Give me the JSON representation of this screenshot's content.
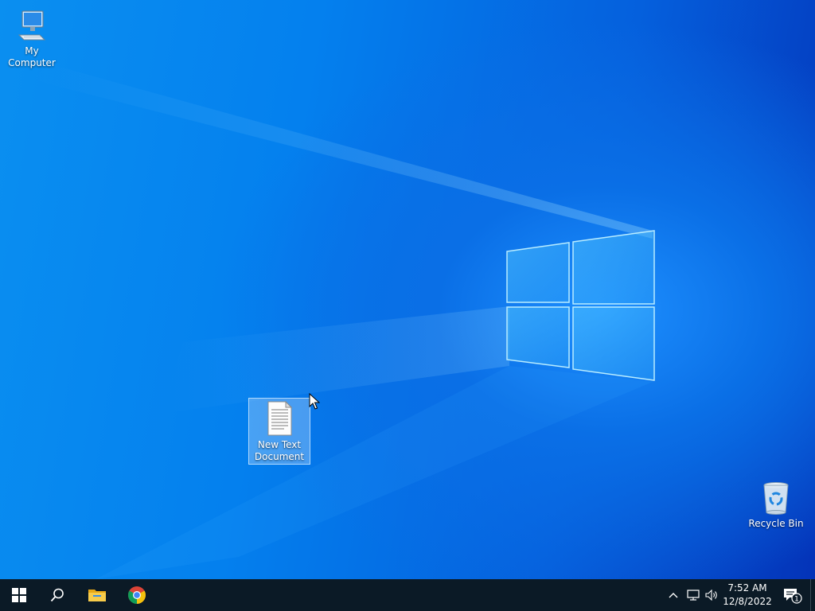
{
  "desktop": {
    "icons": [
      {
        "label": "My Computer",
        "icon": "computer-icon"
      },
      {
        "label": "New Text Document",
        "icon": "text-document-icon",
        "selected": true
      },
      {
        "label": "Recycle Bin",
        "icon": "recycle-bin-icon"
      }
    ]
  },
  "taskbar": {
    "start": {
      "icon": "windows-logo-icon"
    },
    "search": {
      "icon": "search-icon"
    },
    "pinned": [
      {
        "icon": "file-explorer-icon"
      },
      {
        "icon": "chrome-icon"
      }
    ],
    "tray": {
      "icons": [
        "chevron-up-icon",
        "network-icon",
        "volume-icon"
      ],
      "time": "7:52 AM",
      "date": "12/8/2022",
      "notifications_count": "1"
    }
  },
  "colors": {
    "taskbar": "#0b1a26",
    "desktop_accent": "#0a78e8"
  }
}
